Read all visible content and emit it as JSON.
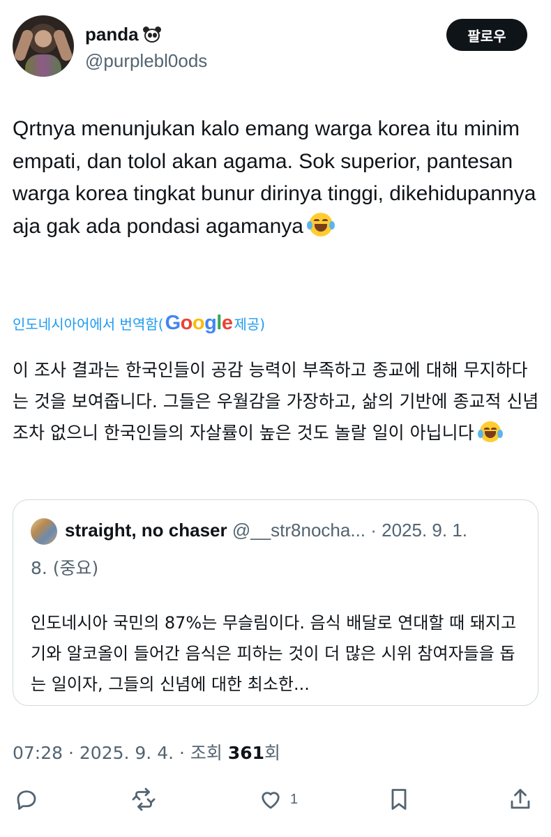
{
  "author": {
    "display_name": "panda",
    "handle": "@purplebl0ods",
    "follow_label": "팔로우"
  },
  "tweet": {
    "text": "Qrtnya menunjukan kalo emang warga korea itu minim empati, dan tolol akan agama. Sok superior, pantesan warga korea tingkat bunur dirinya tinggi, dikehidupannya aja gak ada pondasi agamanya",
    "emoji": "face-with-tears-of-joy"
  },
  "translation": {
    "prefix": "인도네시아어에서 번역함(",
    "provider_g": "G",
    "provider_o1": "o",
    "provider_o2": "o",
    "provider_g2": "g",
    "provider_l": "l",
    "provider_e": "e",
    "suffix": " 제공)",
    "text": "이 조사 결과는 한국인들이 공감 능력이 부족하고 종교에 대해 무지하다는 것을 보여줍니다. 그들은 우월감을 가장하고, 삶의 기반에 종교적 신념조차 없으니 한국인들의 자살률이 높은 것도 놀랄 일이 아닙니다"
  },
  "quote": {
    "name": "straight, no chaser",
    "handle": "@__str8nocha...",
    "date_part1": " · 2025. 9. 1.",
    "date_part2": "8. (중요)",
    "text": "인도네시아 국민의 87%는 무슬림이다. 음식 배달로 연대할 때 돼지고기와 알코올이 들어간 음식은 피하는 것이 더 많은 시위 참여자들을 돕는 일이자, 그들의 신념에 대한 최소한..."
  },
  "meta": {
    "time_date": "07:28 · 2025. 9. 4. · 조회 ",
    "views": "361",
    "views_suffix": "회"
  },
  "actions": {
    "like_count": "1"
  }
}
